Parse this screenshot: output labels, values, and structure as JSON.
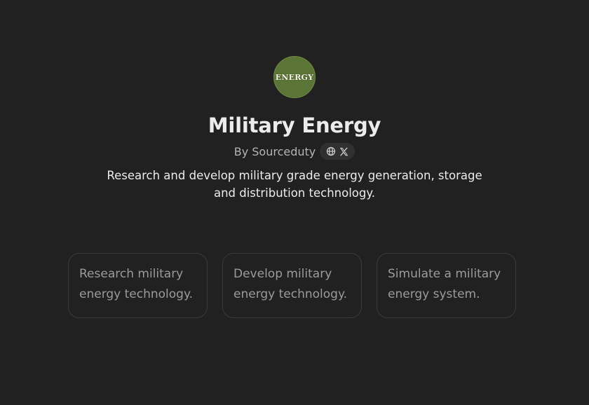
{
  "gpt": {
    "avatar_text": "ENERGY",
    "title": "Military Energy",
    "byline": "By Sourceduty",
    "description": "Research and develop military grade energy generation, storage and distribution technology.",
    "brand_color": "#5b7536"
  },
  "social_links": [
    {
      "icon": "globe-icon"
    },
    {
      "icon": "x-logo-icon"
    }
  ],
  "conversation_starters": [
    {
      "label": "Research military energy technology."
    },
    {
      "label": "Develop military energy technology."
    },
    {
      "label": "Simulate a military energy system."
    }
  ]
}
